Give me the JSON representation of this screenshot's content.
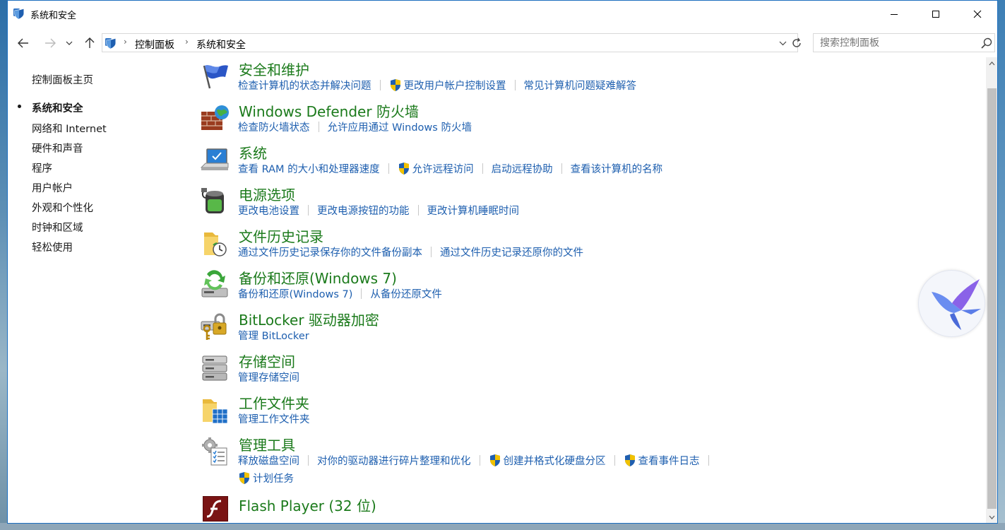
{
  "window": {
    "title": "系统和安全"
  },
  "address": {
    "crumbs": [
      "控制面板",
      "系统和安全"
    ]
  },
  "search": {
    "placeholder": "搜索控制面板"
  },
  "sidebar": {
    "home": "控制面板主页",
    "items": [
      {
        "label": "系统和安全",
        "active": true
      },
      {
        "label": "网络和 Internet"
      },
      {
        "label": "硬件和声音"
      },
      {
        "label": "程序"
      },
      {
        "label": "用户帐户"
      },
      {
        "label": "外观和个性化"
      },
      {
        "label": "时钟和区域"
      },
      {
        "label": "轻松使用"
      }
    ]
  },
  "categories": [
    {
      "title": "安全和维护",
      "icon": "flag-icon",
      "links": [
        {
          "label": "检查计算机的状态并解决问题"
        },
        {
          "label": "更改用户帐户控制设置",
          "shield": true
        },
        {
          "label": "常见计算机问题疑难解答"
        }
      ]
    },
    {
      "title": "Windows Defender 防火墙",
      "icon": "firewall-icon",
      "links": [
        {
          "label": "检查防火墙状态"
        },
        {
          "label": "允许应用通过 Windows 防火墙"
        }
      ]
    },
    {
      "title": "系统",
      "icon": "computer-icon",
      "links": [
        {
          "label": "查看 RAM 的大小和处理器速度"
        },
        {
          "label": "允许远程访问",
          "shield": true
        },
        {
          "label": "启动远程协助"
        },
        {
          "label": "查看该计算机的名称"
        }
      ]
    },
    {
      "title": "电源选项",
      "icon": "battery-icon",
      "links": [
        {
          "label": "更改电池设置"
        },
        {
          "label": "更改电源按钮的功能"
        },
        {
          "label": "更改计算机睡眠时间"
        }
      ]
    },
    {
      "title": "文件历史记录",
      "icon": "file-history-icon",
      "links": [
        {
          "label": "通过文件历史记录保存你的文件备份副本"
        },
        {
          "label": "通过文件历史记录还原你的文件"
        }
      ]
    },
    {
      "title": "备份和还原(Windows 7)",
      "icon": "backup-icon",
      "links": [
        {
          "label": "备份和还原(Windows 7)"
        },
        {
          "label": "从备份还原文件"
        }
      ]
    },
    {
      "title": "BitLocker 驱动器加密",
      "icon": "bitlocker-icon",
      "links": [
        {
          "label": "管理 BitLocker"
        }
      ]
    },
    {
      "title": "存储空间",
      "icon": "storage-icon",
      "links": [
        {
          "label": "管理存储空间"
        }
      ]
    },
    {
      "title": "工作文件夹",
      "icon": "work-folders-icon",
      "links": [
        {
          "label": "管理工作文件夹"
        }
      ]
    },
    {
      "title": "管理工具",
      "icon": "admin-tools-icon",
      "links": [
        {
          "label": "释放磁盘空间"
        },
        {
          "label": "对你的驱动器进行碎片整理和优化"
        },
        {
          "label": "创建并格式化硬盘分区",
          "shield": true
        },
        {
          "label": "查看事件日志",
          "shield": true
        }
      ],
      "links2": [
        {
          "label": "计划任务",
          "shield": true
        }
      ]
    },
    {
      "title": "Flash Player (32 位)",
      "icon": "flash-icon",
      "links": []
    }
  ],
  "colors": {
    "category_title": "#1b7a1b",
    "link": "#1e5faf",
    "window_border": "#1d6fbf"
  }
}
